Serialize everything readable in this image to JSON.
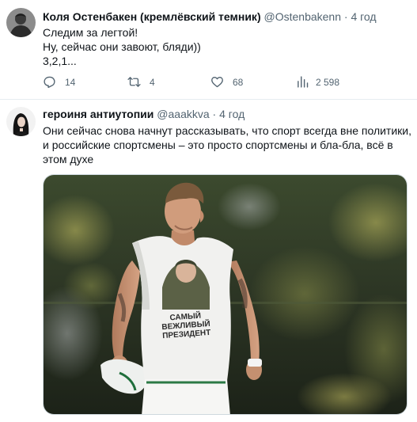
{
  "tweets": [
    {
      "author": {
        "name": "Коля Остенбакен (кремлёвский темник)",
        "handle": "@Ostenbakenn",
        "avatar_icon": "user-avatar-icon"
      },
      "time": "4 год",
      "lines": [
        "Следим за легтой!",
        "Ну, сейчас они завоют, бляди))",
        "3,2,1..."
      ],
      "actions": {
        "reply_count": "14",
        "retweet_count": "4",
        "like_count": "68",
        "view_count": "2 598"
      }
    },
    {
      "author": {
        "name": "героиня антиутопии",
        "handle": "@aaakkva",
        "avatar_icon": "user-avatar-icon"
      },
      "time": "4 год",
      "lines": [
        "Они сейчас снова начнут рассказывать, что спорт всегда вне политики,",
        "и российские спортсмены – это просто спортсмены и бла-бла, всё в",
        "этом духе"
      ],
      "media": {
        "shirt_text_lines": [
          "САМЫЙ",
          "ВЕЖЛИВЫЙ",
          "ПРЕЗИДЕНТ"
        ]
      }
    }
  ],
  "separator": "·",
  "colors": {
    "text": "#0f1419",
    "secondary": "#536471",
    "border": "#e6ecf0"
  }
}
